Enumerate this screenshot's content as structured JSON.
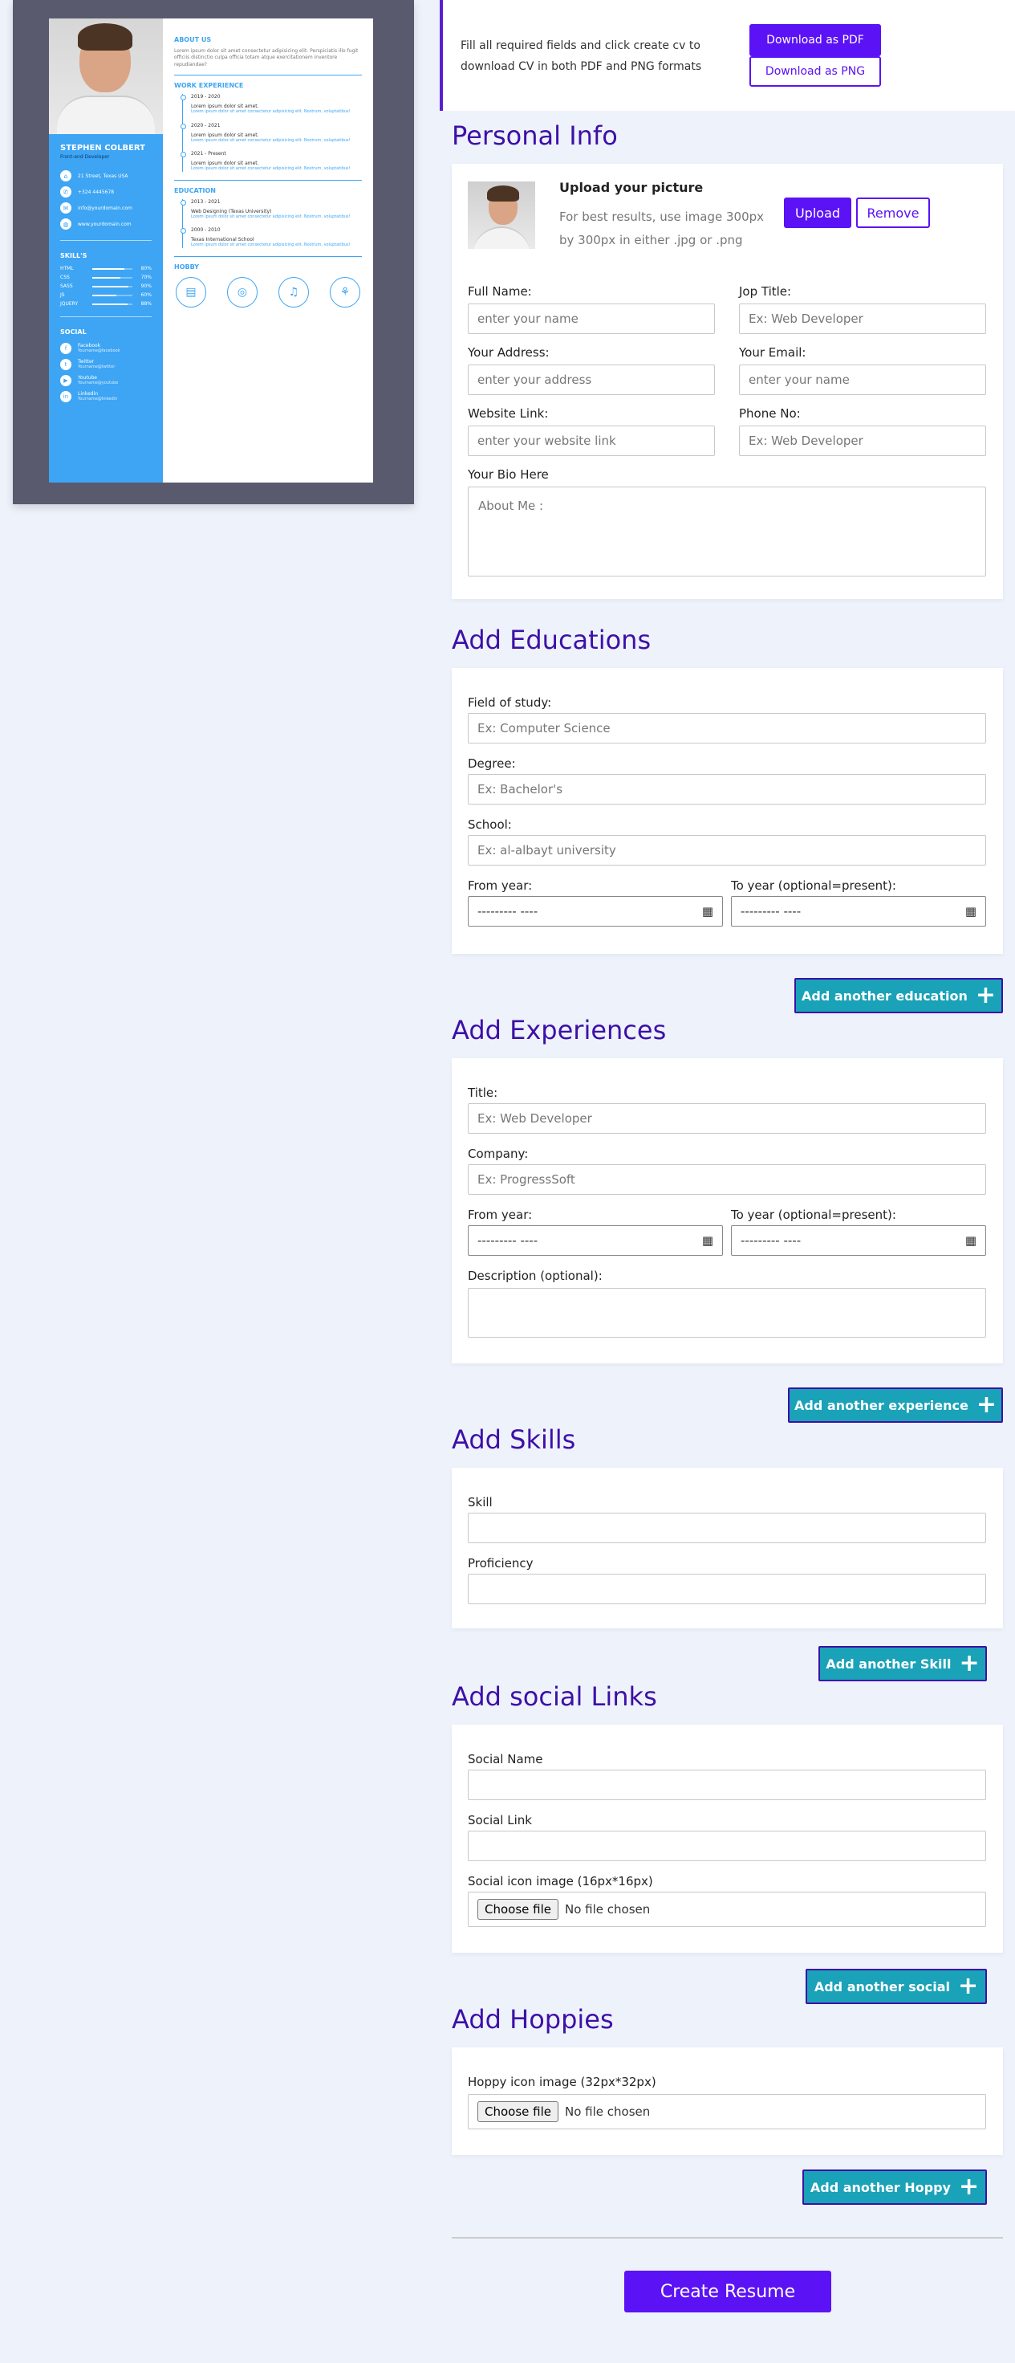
{
  "preview": {
    "name": "STEPHEN COLBERT",
    "role": "Front-end Developer",
    "contacts": [
      {
        "icon": "home",
        "text": "21 Street, Texas USA"
      },
      {
        "icon": "phone",
        "text": "+324 4445678"
      },
      {
        "icon": "mail",
        "text": "info@yourdomain.com"
      },
      {
        "icon": "globe",
        "text": "www.yourdomain.com"
      }
    ],
    "skills_title": "SKILL'S",
    "skills": [
      {
        "name": "HTML",
        "pct": "80%",
        "level": 0.8
      },
      {
        "name": "CSS",
        "pct": "70%",
        "level": 0.7
      },
      {
        "name": "SASS",
        "pct": "90%",
        "level": 0.9
      },
      {
        "name": "JS",
        "pct": "60%",
        "level": 0.6
      },
      {
        "name": "JQUERY",
        "pct": "88%",
        "level": 0.88
      }
    ],
    "social_title": "SOCIAL",
    "socials": [
      {
        "icon": "f",
        "name": "Facebook",
        "handle": "Yourname@facebook"
      },
      {
        "icon": "t",
        "name": "Twitter",
        "handle": "Yourname@twitter"
      },
      {
        "icon": "y",
        "name": "Youtube",
        "handle": "Yourname@youtube"
      },
      {
        "icon": "in",
        "name": "Linkedin",
        "handle": "Yourname@linkedin"
      }
    ],
    "about_title": "ABOUT US",
    "about_text": "Lorem ipsum dolor sit amet consectetur adipisicing elit. Perspiciatis illo fugit officiis distinctio culpa officia totam atque exercitationem inventore repudiandae?",
    "work_title": "WORK EXPERIENCE",
    "work": [
      {
        "date": "2019 - 2020",
        "heading": "Lorem ipsum dolor sit amet.",
        "body": "Lorem ipsum dolor sit amet consectetur adipisicing elit. Nostrum, voluptatibus!"
      },
      {
        "date": "2020 - 2021",
        "heading": "Lorem ipsum dolor sit amet.",
        "body": "Lorem ipsum dolor sit amet consectetur adipisicing elit. Nostrum, voluptatibus!"
      },
      {
        "date": "2021 - Present",
        "heading": "Lorem ipsum dolor sit amet.",
        "body": "Lorem ipsum dolor sit amet consectetur adipisicing elit. Nostrum, voluptatibus!"
      }
    ],
    "edu_title": "EDUCATION",
    "edu": [
      {
        "date": "2013 - 2021",
        "heading": "Web Designing (Texas University)",
        "body": "Lorem ipsum dolor sit amet consectetur adipisicing elit. Nostrum, voluptatibus!"
      },
      {
        "date": "2000 - 2010",
        "heading": "Texas International School",
        "body": "Lorem ipsum dolor sit amet consectetur adipisicing elit. Nostrum, voluptatibus!"
      }
    ],
    "hobby_title": "HOBBY",
    "hobbies": [
      "book-icon",
      "gamepad-icon",
      "music-icon",
      "running-icon"
    ]
  },
  "topbar": {
    "text": "Fill all required fields and click create cv to download CV in both PDF and PNG formats",
    "pdf_label": "Download as PDF",
    "png_label": "Download as PNG"
  },
  "personal": {
    "title": "Personal Info",
    "upload_title": "Upload your picture",
    "upload_hint": "For best results, use image 300px by 300px in either .jpg or .png",
    "upload_label": "Upload",
    "remove_label": "Remove",
    "full_name_label": "Full Name:",
    "full_name_ph": "enter your name",
    "job_title_label": "Jop Title:",
    "job_title_ph": "Ex: Web Developer",
    "address_label": "Your Address:",
    "address_ph": "enter your address",
    "email_label": "Your Email:",
    "email_ph": "enter your name",
    "website_label": "Website Link:",
    "website_ph": "enter your website link",
    "phone_label": "Phone No:",
    "phone_ph": "Ex: Web Developer",
    "bio_label": "Your Bio Here",
    "bio_ph": "About Me :"
  },
  "education": {
    "title": "Add Educations",
    "field_label": "Field of study:",
    "field_ph": "Ex: Computer Science",
    "degree_label": "Degree:",
    "degree_ph": "Ex: Bachelor's",
    "school_label": "School:",
    "school_ph": "Ex: al-albayt university",
    "from_label": "From year:",
    "to_label": "To year (optional=present):",
    "date_ph": "--------- ----",
    "add_label": "Add another education"
  },
  "experience": {
    "title": "Add Experiences",
    "title_label": "Title:",
    "title_ph": "Ex: Web Developer",
    "company_label": "Company:",
    "company_ph": "Ex: ProgressSoft",
    "from_label": "From year:",
    "to_label": "To year (optional=present):",
    "date_ph": "--------- ----",
    "desc_label": "Description (optional):",
    "add_label": "Add another experience"
  },
  "skills": {
    "title": "Add Skills",
    "skill_label": "Skill",
    "prof_label": "Proficiency",
    "add_label": "Add another Skill"
  },
  "social": {
    "title": "Add social Links",
    "name_label": "Social Name",
    "link_label": "Social Link",
    "icon_label": "Social icon image (16px*16px)",
    "choose_label": "Choose file",
    "no_file": "No file chosen",
    "add_label": "Add another social"
  },
  "hobbies": {
    "title": "Add Hoppies",
    "icon_label": "Hoppy icon image (32px*32px)",
    "choose_label": "Choose file",
    "no_file": "No file chosen",
    "add_label": "Add another Hoppy"
  },
  "create_label": "Create Resume"
}
